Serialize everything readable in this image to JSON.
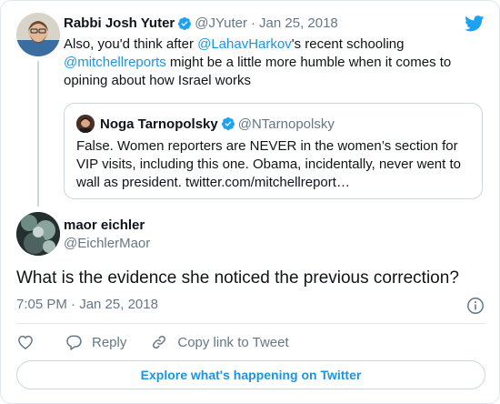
{
  "parent_tweet": {
    "author_name": "Rabbi Josh Yuter",
    "author_handle": "@JYuter",
    "separator": "·",
    "date": "Jan 25, 2018",
    "text_part1": "Also, you'd think after ",
    "mention1": "@LahavHarkov",
    "text_part2": "'s recent schooling ",
    "mention2": "@mitchellreports",
    "text_part3": " might be a little more humble when it comes to opining about how Israel works"
  },
  "quoted_tweet": {
    "author_name": "Noga Tarnopolsky",
    "author_handle": "@NTarnopolsky",
    "text": "False. Women reporters are NEVER in the women’s section for VIP visits, including this one. Obama, incidentally, never went to wall as president. twitter.com/mitchellreport…"
  },
  "main_tweet": {
    "author_name": "maor eichler",
    "author_handle": "@EichlerMaor",
    "text": "What is the evidence she noticed the previous correction?",
    "time": "7:05 PM · Jan 25, 2018"
  },
  "actions": {
    "reply_label": "Reply",
    "copy_link_label": "Copy link to Tweet"
  },
  "explore_label": "Explore what's happening on Twitter",
  "colors": {
    "link": "#1b95e0",
    "verified": "#1da1f2",
    "muted": "#657786",
    "border": "#e1e8ed"
  },
  "icons": {
    "brand": "twitter-bird-icon",
    "verified": "verified-badge-icon",
    "info": "info-icon",
    "like": "heart-icon",
    "reply": "reply-bubble-icon",
    "copy_link": "link-icon"
  }
}
